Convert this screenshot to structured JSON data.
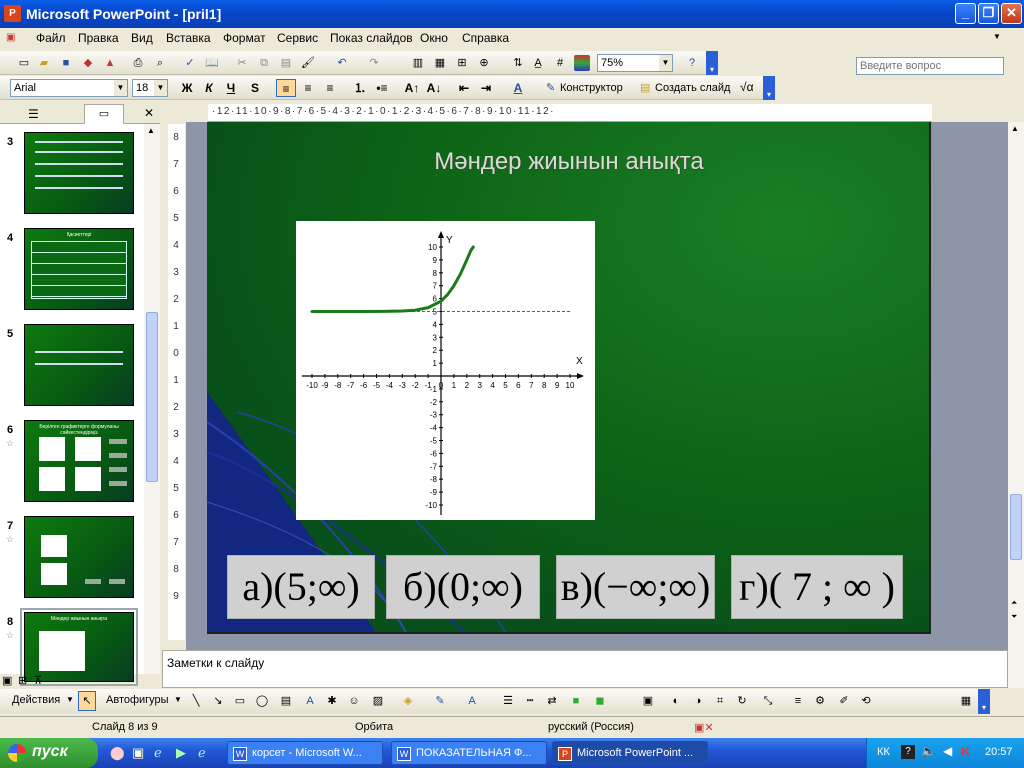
{
  "window": {
    "title": "Microsoft PowerPoint - [pril1]",
    "app_icon_letter": "P"
  },
  "menu": {
    "items": [
      "Файл",
      "Правка",
      "Вид",
      "Вставка",
      "Формат",
      "Сервис",
      "Показ слайдов",
      "Окно",
      "Справка"
    ],
    "help_placeholder": "Введите вопрос"
  },
  "toolbar": {
    "zoom": "75%"
  },
  "format_toolbar": {
    "font": "Arial",
    "size": "18",
    "bold": "Ж",
    "italic": "К",
    "underline": "Ч",
    "shadow": "S",
    "designer": "Конструктор",
    "new_slide": "Создать слайд"
  },
  "thumbnails": [
    {
      "num": "3",
      "title": ""
    },
    {
      "num": "4",
      "title": "Қасиеттері"
    },
    {
      "num": "5",
      "title": ""
    },
    {
      "num": "6",
      "title": "Берілген графиктерге формуланы сәйкестендіріңіз"
    },
    {
      "num": "7",
      "title": ""
    },
    {
      "num": "8",
      "title": "Мәндер жиынын анықта"
    }
  ],
  "slide": {
    "title": "Мәндер жиынын анықта",
    "answers": [
      "а)(5;∞)",
      "б)(0;∞)",
      "в)(−∞;∞)",
      "г)( 7 ; ∞ )"
    ]
  },
  "chart_data": {
    "type": "line",
    "title": "",
    "xlabel": "X",
    "ylabel": "Y",
    "xlim": [
      -10,
      10
    ],
    "ylim": [
      -10,
      10
    ],
    "x_ticks": [
      -10,
      -9,
      -8,
      -7,
      -6,
      -5,
      -4,
      -3,
      -2,
      -1,
      0,
      1,
      2,
      3,
      4,
      5,
      6,
      7,
      8,
      9,
      10
    ],
    "y_ticks": [
      -10,
      -9,
      -8,
      -7,
      -6,
      -5,
      -4,
      -3,
      -2,
      -1,
      1,
      2,
      3,
      4,
      5,
      6,
      7,
      8,
      9,
      10
    ],
    "series": [
      {
        "name": "",
        "color": "#1a7a1a",
        "x": [
          -10,
          -8,
          -6,
          -4,
          -3,
          -2,
          -1,
          0,
          0.5,
          1,
          1.5,
          2,
          2.3,
          2.5
        ],
        "y": [
          5.0,
          5.0,
          5.0,
          5.02,
          5.04,
          5.1,
          5.3,
          5.8,
          6.3,
          7.0,
          7.9,
          9.0,
          9.7,
          10.0
        ]
      }
    ],
    "asymptote": {
      "y": 5,
      "color": "#c0392b",
      "style": "dashed"
    },
    "grid": false
  },
  "notes": {
    "placeholder": "Заметки к слайду"
  },
  "drawing_toolbar": {
    "actions": "Действия",
    "autoshapes": "Автофигуры"
  },
  "status": {
    "slide": "Слайд 8 из 9",
    "design": "Орбита",
    "language": "русский (Россия)"
  },
  "taskbar": {
    "start": "пуск",
    "tasks": [
      "корсет - Microsoft W...",
      "ПОКАЗАТЕЛЬНАЯ Ф...",
      "Microsoft PowerPoint ..."
    ],
    "lang": "КК",
    "clock": "20:57"
  }
}
